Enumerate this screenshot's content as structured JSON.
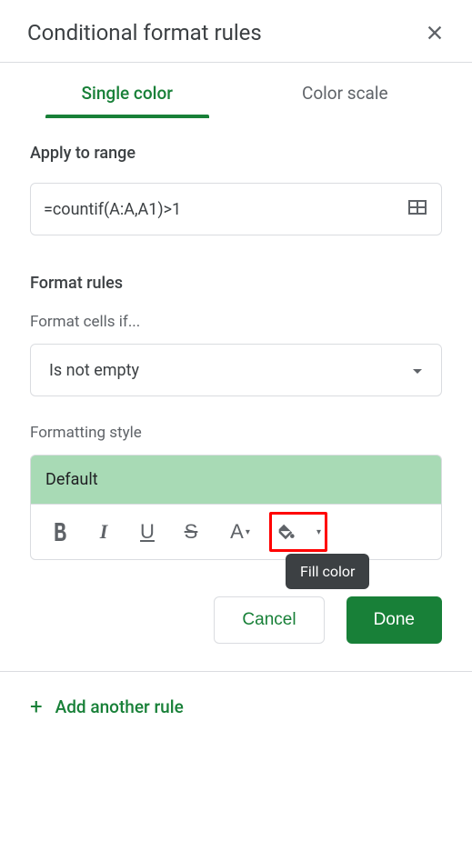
{
  "header": {
    "title": "Conditional format rules"
  },
  "tabs": {
    "single_color": "Single color",
    "color_scale": "Color scale"
  },
  "apply_to_range": {
    "label": "Apply to range",
    "value": "=countif(A:A,A1)>1"
  },
  "format_rules": {
    "label": "Format rules",
    "format_cells_if": "Format cells if...",
    "condition_value": "Is not empty",
    "formatting_style": "Formatting style",
    "style_name": "Default"
  },
  "tooltip": {
    "fill_color": "Fill color"
  },
  "buttons": {
    "cancel": "Cancel",
    "done": "Done"
  },
  "add_rule": "Add another rule"
}
